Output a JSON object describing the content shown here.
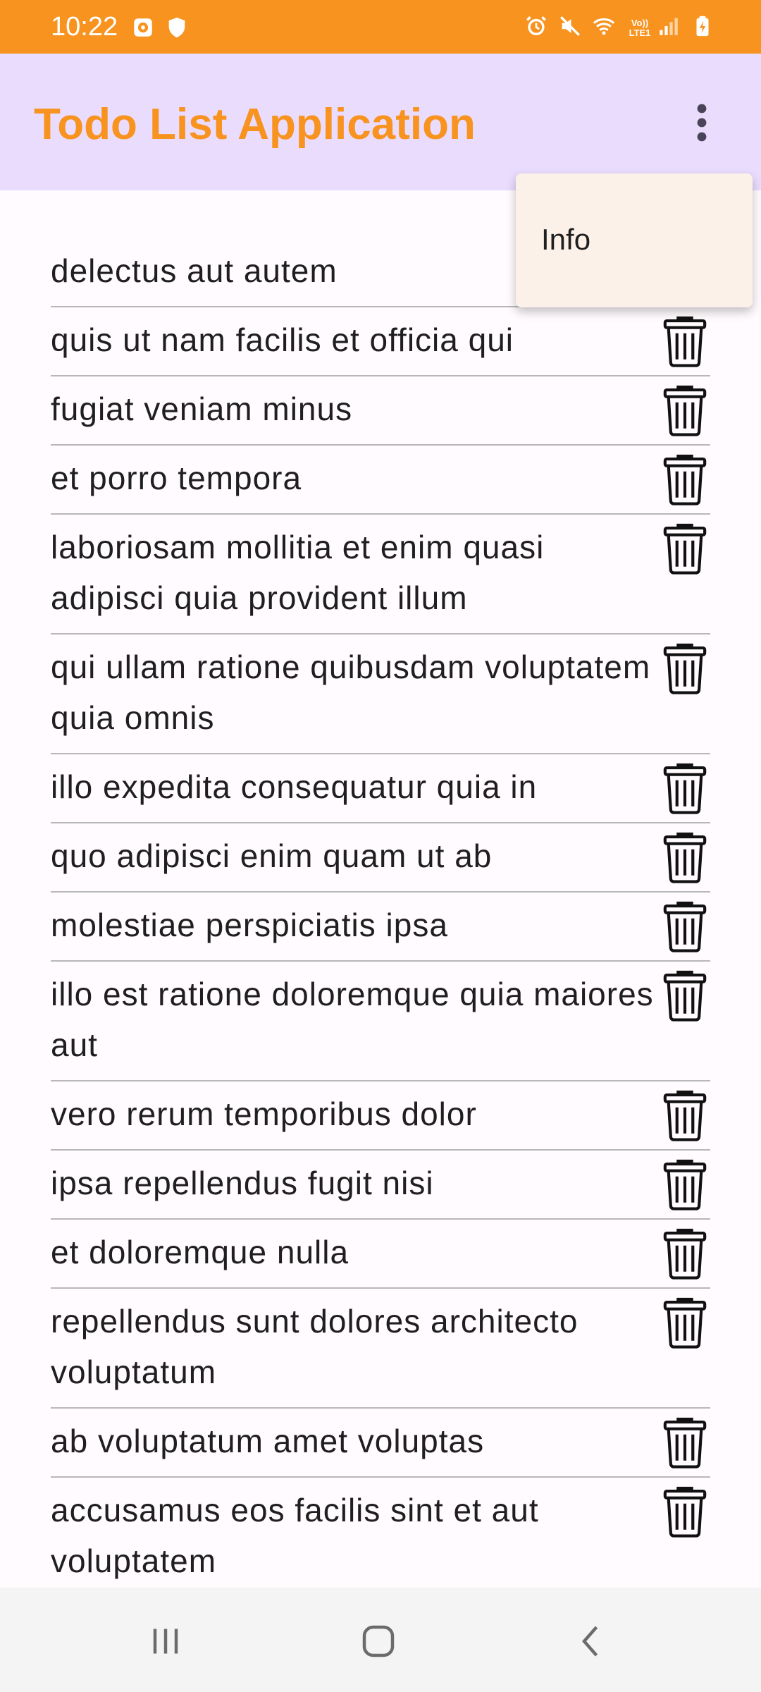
{
  "status_bar": {
    "time": "10:22",
    "icons_left": [
      "notification-app-icon",
      "shield-icon"
    ],
    "icons_right": [
      "alarm-icon",
      "mute-icon",
      "wifi-icon",
      "volte-signal-icon",
      "battery-charging-icon"
    ],
    "volte_label": "Vo)) LTE1"
  },
  "app_bar": {
    "title": "Todo List Application",
    "overflow_icon": "more-vert-icon"
  },
  "menu": {
    "items": [
      {
        "label": "Info"
      }
    ]
  },
  "todos": [
    {
      "title": "delectus aut autem"
    },
    {
      "title": "quis ut nam facilis et officia qui"
    },
    {
      "title": "fugiat veniam minus"
    },
    {
      "title": "et porro tempora"
    },
    {
      "title": "laboriosam mollitia et enim quasi adipisci quia provident illum"
    },
    {
      "title": "qui ullam ratione quibusdam voluptatem quia omnis"
    },
    {
      "title": "illo expedita consequatur quia in"
    },
    {
      "title": "quo adipisci enim quam ut ab"
    },
    {
      "title": "molestiae perspiciatis ipsa"
    },
    {
      "title": "illo est ratione doloremque quia maiores aut"
    },
    {
      "title": "vero rerum temporibus dolor"
    },
    {
      "title": "ipsa repellendus fugit nisi"
    },
    {
      "title": "et doloremque nulla"
    },
    {
      "title": "repellendus sunt dolores architecto voluptatum"
    },
    {
      "title": "ab voluptatum amet voluptas"
    },
    {
      "title": "accusamus eos facilis sint et aut voluptatem"
    }
  ],
  "nav_bar": {
    "buttons": [
      "recent-apps-icon",
      "home-icon",
      "back-icon"
    ]
  },
  "colors": {
    "accent": "#f7931e",
    "app_bar_bg": "#eadcfd",
    "menu_bg": "#fbf1e8",
    "divider": "#b8b8b8"
  }
}
